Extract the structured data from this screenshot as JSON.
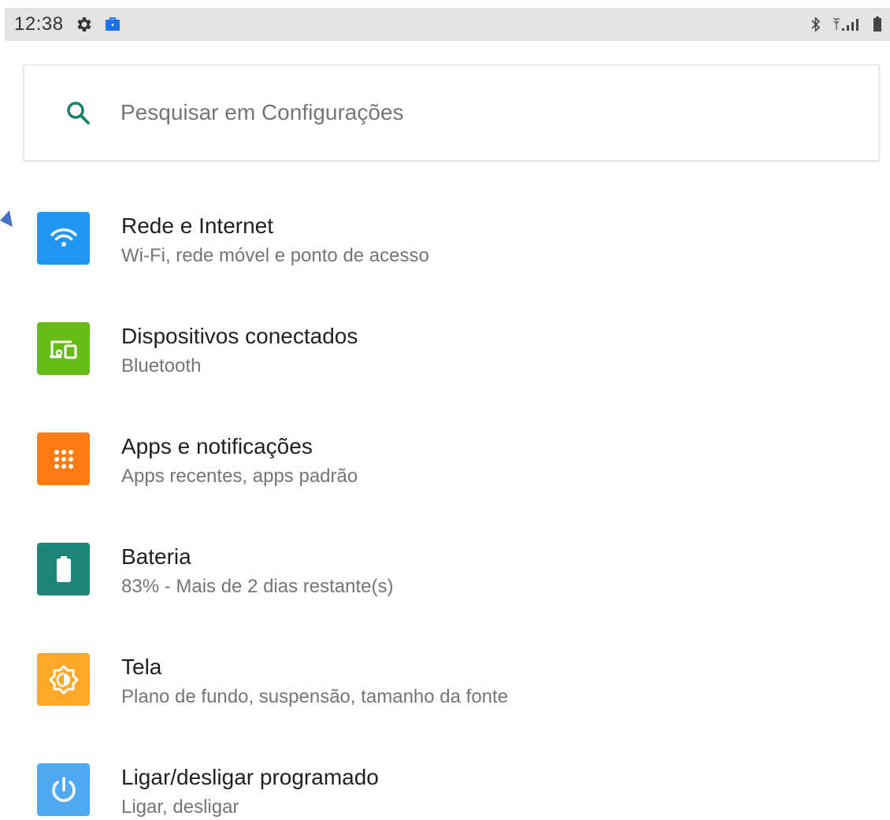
{
  "status_bar": {
    "time": "12:38",
    "left_icons": [
      "gear-icon",
      "briefcase-icon"
    ],
    "right_icons": [
      "bluetooth-icon",
      "signal-icon",
      "battery-icon"
    ],
    "background": "#e3e3e3"
  },
  "search": {
    "placeholder": "Pesquisar em Configurações",
    "icon": "search-icon",
    "icon_color": "#16806f"
  },
  "settings": {
    "items": [
      {
        "title": "Rede e Internet",
        "subtitle": "Wi-Fi, rede móvel e ponto de acesso",
        "icon": "wifi-icon",
        "color": "#2196f3"
      },
      {
        "title": "Dispositivos conectados",
        "subtitle": "Bluetooth",
        "icon": "connected-devices-icon",
        "color": "#66bb16"
      },
      {
        "title": "Apps e notificações",
        "subtitle": "Apps recentes, apps padrão",
        "icon": "apps-grid-icon",
        "color": "#ff7b12"
      },
      {
        "title": "Bateria",
        "subtitle": "83% - Mais de 2 dias restante(s)",
        "icon": "battery-icon",
        "color": "#1e8578"
      },
      {
        "title": "Tela",
        "subtitle": "Plano de fundo, suspensão, tamanho da fonte",
        "icon": "brightness-icon",
        "color": "#ffa726"
      },
      {
        "title": "Ligar/desligar programado",
        "subtitle": "Ligar, desligar",
        "icon": "power-icon",
        "color": "#4fa8f0"
      }
    ]
  }
}
